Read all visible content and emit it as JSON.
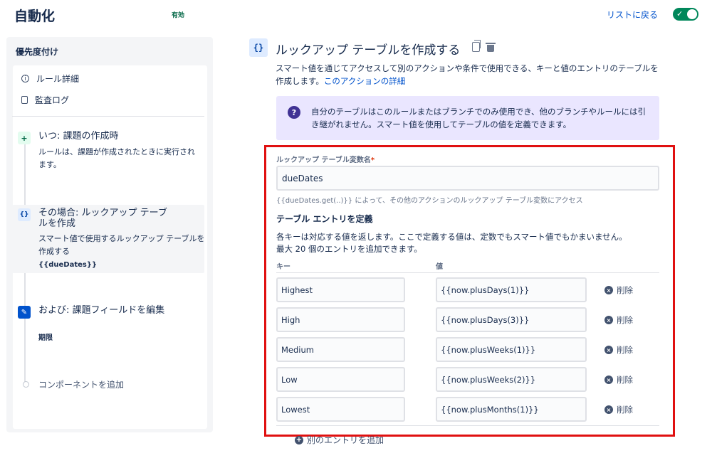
{
  "header": {
    "title": "自動化",
    "status": "有効",
    "back_link": "リストに戻る",
    "toggle_on": true
  },
  "sidebar": {
    "heading": "優先度付け",
    "links": [
      {
        "label": "ルール詳細",
        "icon": "info-icon"
      },
      {
        "label": "監査ログ",
        "icon": "document-icon"
      }
    ],
    "steps": [
      {
        "badge": "+",
        "title": "いつ: 課題の作成時",
        "desc": "ルールは、課題が作成されたときに実行されます。",
        "extra": ""
      },
      {
        "badge": "{}",
        "title": "その場合: ルックアップ テーブルを作成",
        "desc": "スマート値で使用するルックアップ テーブルを作成する",
        "extra": "{{dueDates}}"
      },
      {
        "badge": "✎",
        "title": "および: 課題フィールドを編集",
        "desc": "",
        "extra": "期限"
      }
    ],
    "add_component": "コンポーネントを追加"
  },
  "action": {
    "icon_text": "{}",
    "title": "ルックアップ テーブルを作成する",
    "desc": "スマート値を通じてアクセスして別のアクションや条件で使用できる、キーと値のエントリのテーブルを作成します。",
    "desc_link": "このアクションの詳細",
    "info": "自分のテーブルはこのルールまたはブランチでのみ使用でき、他のブランチやルールには引き継がれません。スマート値を使用してテーブルの値を定義できます。",
    "var_label": "ルックアップ テーブル変数名",
    "var_required": "*",
    "var_value": "dueDates",
    "helper": "{{dueDates.get(..)}} によって、その他のアクションのルックアップ テーブル変数にアクセス",
    "section_title": "テーブル エントリを定義",
    "section_desc_1": "各キーは対応する値を返します。ここで定義する値は、定数でもスマート値でもかまいません。",
    "section_desc_2": "最大 20 個のエントリを追加できます。",
    "col_key": "キー",
    "col_value": "値",
    "delete_label": "削除",
    "add_entry": "別のエントリを追加",
    "entries": [
      {
        "key": "Highest",
        "value": "{{now.plusDays(1)}}"
      },
      {
        "key": "High",
        "value": "{{now.plusDays(3)}}"
      },
      {
        "key": "Medium",
        "value": "{{now.plusWeeks(1)}}"
      },
      {
        "key": "Low",
        "value": "{{now.plusWeeks(2)}}"
      },
      {
        "key": "Lowest",
        "value": "{{now.plusMonths(1)}}"
      }
    ]
  }
}
